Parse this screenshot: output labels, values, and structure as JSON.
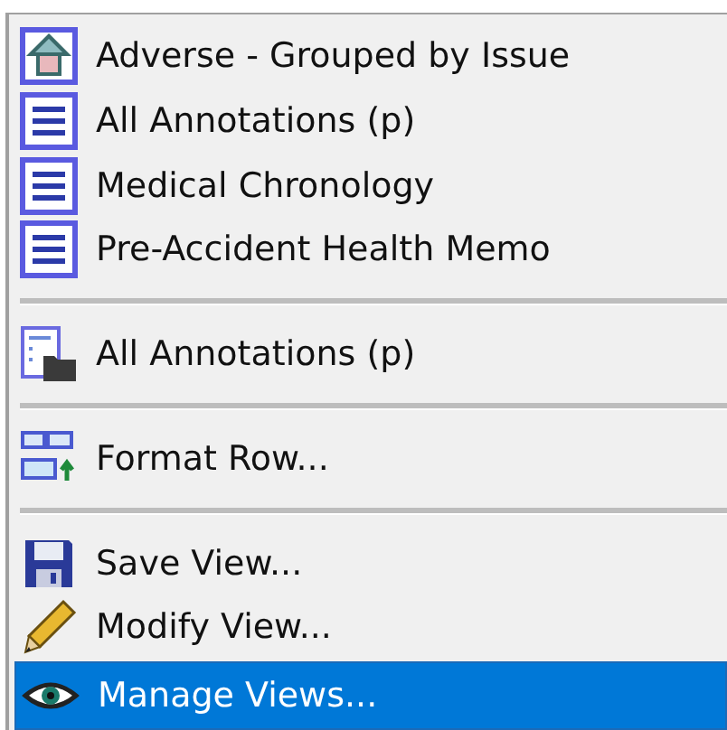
{
  "menu": {
    "items": [
      {
        "kind": "item",
        "label": "Adverse - Grouped by Issue",
        "selected": false
      },
      {
        "kind": "item",
        "label": "All Annotations (p)",
        "selected": false
      },
      {
        "kind": "item",
        "label": "Medical Chronology",
        "selected": false
      },
      {
        "kind": "item",
        "label": "Pre-Accident Health Memo",
        "selected": false
      },
      {
        "kind": "separator"
      },
      {
        "kind": "item",
        "label": "All Annotations (p)",
        "selected": false
      },
      {
        "kind": "separator"
      },
      {
        "kind": "item",
        "label": "Format Row...",
        "selected": false
      },
      {
        "kind": "separator"
      },
      {
        "kind": "item",
        "label": "Save View...",
        "selected": false
      },
      {
        "kind": "item",
        "label": "Modify View...",
        "selected": false
      },
      {
        "kind": "item",
        "label": "Manage Views...",
        "selected": true
      }
    ]
  }
}
